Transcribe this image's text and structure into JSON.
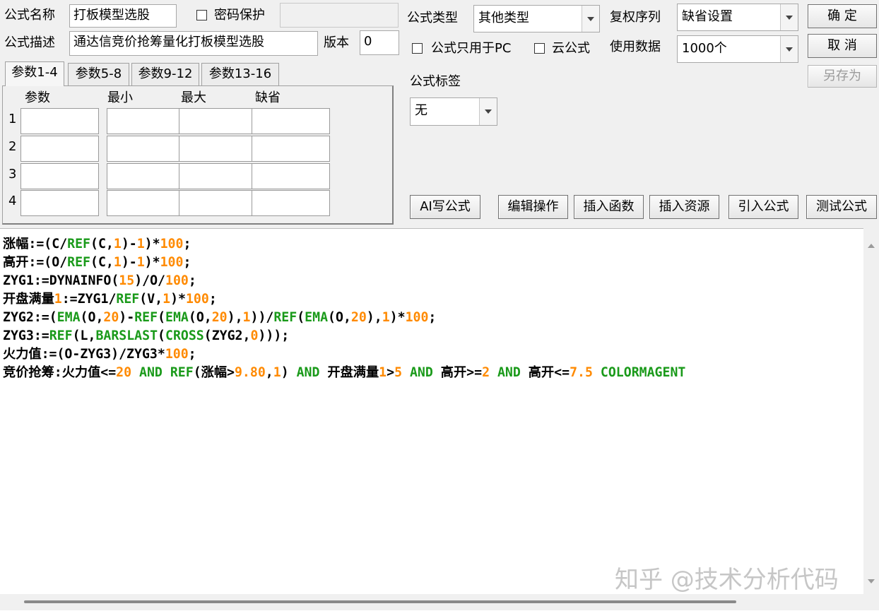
{
  "form": {
    "name_label": "公式名称",
    "name_value": "打板模型选股",
    "password_label": "密码保护",
    "password_value": "",
    "desc_label": "公式描述",
    "desc_value": "通达信竞价抢筹量化打板模型选股",
    "version_label": "版本",
    "version_value": "0",
    "type_label": "公式类型",
    "type_value": "其他类型",
    "fq_label": "复权序列",
    "fq_value": "缺省设置",
    "pc_only_label": "公式只用于PC",
    "cloud_label": "云公式",
    "usedata_label": "使用数据",
    "usedata_value": "1000个",
    "tag_label": "公式标签",
    "tag_value": "无"
  },
  "buttons": {
    "ok": "确 定",
    "cancel": "取 消",
    "save_as": "另存为",
    "ai": "AI写公式",
    "edit_ops": "编辑操作",
    "insert_func": "插入函数",
    "insert_res": "插入资源",
    "import": "引入公式",
    "test": "测试公式"
  },
  "tabs": [
    "参数1-4",
    "参数5-8",
    "参数9-12",
    "参数13-16"
  ],
  "param_headers": [
    "参数",
    "最小",
    "最大",
    "缺省"
  ],
  "param_rows": [
    "1",
    "2",
    "3",
    "4"
  ],
  "code_lines": [
    "涨幅:=(C/REF(C,1)-1)*100;",
    "高开:=(O/REF(C,1)-1)*100;",
    "ZYG1:=DYNAINFO(15)/O/100;",
    "开盘满量1:=ZYG1/REF(V,1)*100;",
    "ZYG2:=(EMA(O,20)-REF(EMA(O,20),1))/REF(EMA(O,20),1)*100;",
    "ZYG3:=REF(L,BARSLAST(CROSS(ZYG2,0)));",
    "火力值:=(O-ZYG3)/ZYG3*100;",
    "竞价抢筹:火力值<=20 AND REF(涨幅>9.80,1) AND 开盘满量1>5 AND 高开>=2 AND 高开<=7.5 COLORMAGENT"
  ],
  "watermark": "知乎 @技术分析代码"
}
